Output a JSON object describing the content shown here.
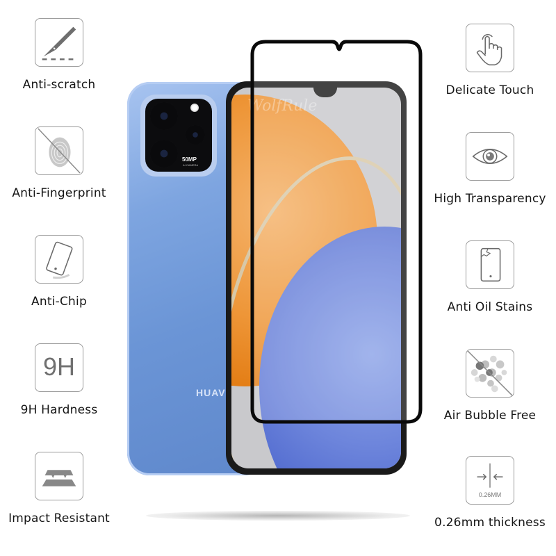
{
  "features_left": [
    {
      "id": "anti-scratch",
      "label": "Anti-scratch",
      "icon": "scalpel-icon"
    },
    {
      "id": "anti-fingerprint",
      "label": "Anti-Fingerprint",
      "icon": "fingerprint-crossed-icon"
    },
    {
      "id": "anti-chip",
      "label": "Anti-Chip",
      "icon": "tilted-phone-icon"
    },
    {
      "id": "9h-hardness",
      "label": "9H Hardness",
      "icon": "9h-text-icon",
      "icon_text": "9H"
    },
    {
      "id": "impact-resistant",
      "label": "Impact Resistant",
      "icon": "layers-impact-icon"
    }
  ],
  "features_right": [
    {
      "id": "delicate-touch",
      "label": "Delicate Touch",
      "icon": "touch-hand-icon"
    },
    {
      "id": "high-transparency",
      "label": "High Transparency",
      "icon": "eye-icon"
    },
    {
      "id": "anti-oil-stains",
      "label": "Anti Oil Stains",
      "icon": "cracked-phone-icon"
    },
    {
      "id": "air-bubble-free",
      "label": "Air Bubble Free",
      "icon": "bubbles-crossed-icon"
    },
    {
      "id": "thickness",
      "label": "0.26mm thickness",
      "icon": "thickness-arrows-icon",
      "icon_text": "0.26MM"
    }
  ],
  "phone": {
    "brand_text": "HUAV",
    "camera_text": "50MP",
    "camera_subtext": "AI CAMERA",
    "watermark": "WolfRule"
  },
  "colors": {
    "phone_blue": "#6b95d6",
    "icon_gray": "#7a7a7a",
    "frame_black": "#0a0a0a"
  }
}
